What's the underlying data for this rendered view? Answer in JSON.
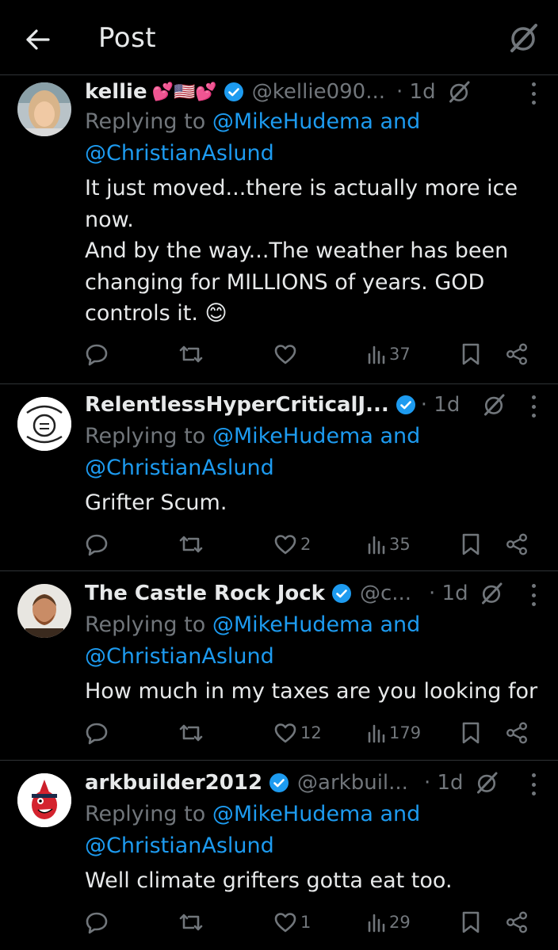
{
  "header": {
    "title": "Post"
  },
  "replies": [
    {
      "name": "kellie",
      "emoji": "💕🇺🇸💕",
      "handle": "@kellie090...",
      "time": "· 1d",
      "replying_prefix": "Replying to ",
      "replying_to_1": "@MikeHudema and",
      "replying_to_2": "@ChristianAslund",
      "text": "It just moved...there is actually more ice\nnow.\nAnd by the way...The weather has been\nchanging for MILLIONS of years. GOD\ncontrols it. 😊",
      "likes": "",
      "views": "37"
    },
    {
      "name": "RelentlessHyperCriticalJ...",
      "emoji": "",
      "handle": "",
      "time": "· 1d",
      "replying_prefix": "Replying to ",
      "replying_to_1": "@MikeHudema and",
      "replying_to_2": "@ChristianAslund",
      "text": "Grifter Scum.",
      "likes": "2",
      "views": "35"
    },
    {
      "name": "The Castle Rock Jock",
      "emoji": "",
      "handle": "@c...",
      "time": "· 1d",
      "replying_prefix": "Replying to ",
      "replying_to_1": "@MikeHudema and",
      "replying_to_2": "@ChristianAslund",
      "text": "How much in my taxes are you looking for",
      "likes": "12",
      "views": "179"
    },
    {
      "name": "arkbuilder2012",
      "emoji": "",
      "handle": "@arkbuil...",
      "time": "· 1d",
      "replying_prefix": "Replying to ",
      "replying_to_1": "@MikeHudema and",
      "replying_to_2": "@ChristianAslund",
      "text": "Well climate grifters gotta eat too.",
      "likes": "1",
      "views": "29"
    }
  ],
  "icons": {
    "back": "arrow-left-icon",
    "grok": "grok-icon",
    "verified": "verified-badge-icon",
    "reply": "reply-icon",
    "repost": "repost-icon",
    "like": "heart-icon",
    "views": "views-icon",
    "bookmark": "bookmark-icon",
    "share": "share-icon"
  },
  "colors": {
    "background": "#000000",
    "text": "#e7e9ea",
    "muted": "#71767b",
    "link": "#1d9bf0",
    "divider": "#2f3336"
  }
}
